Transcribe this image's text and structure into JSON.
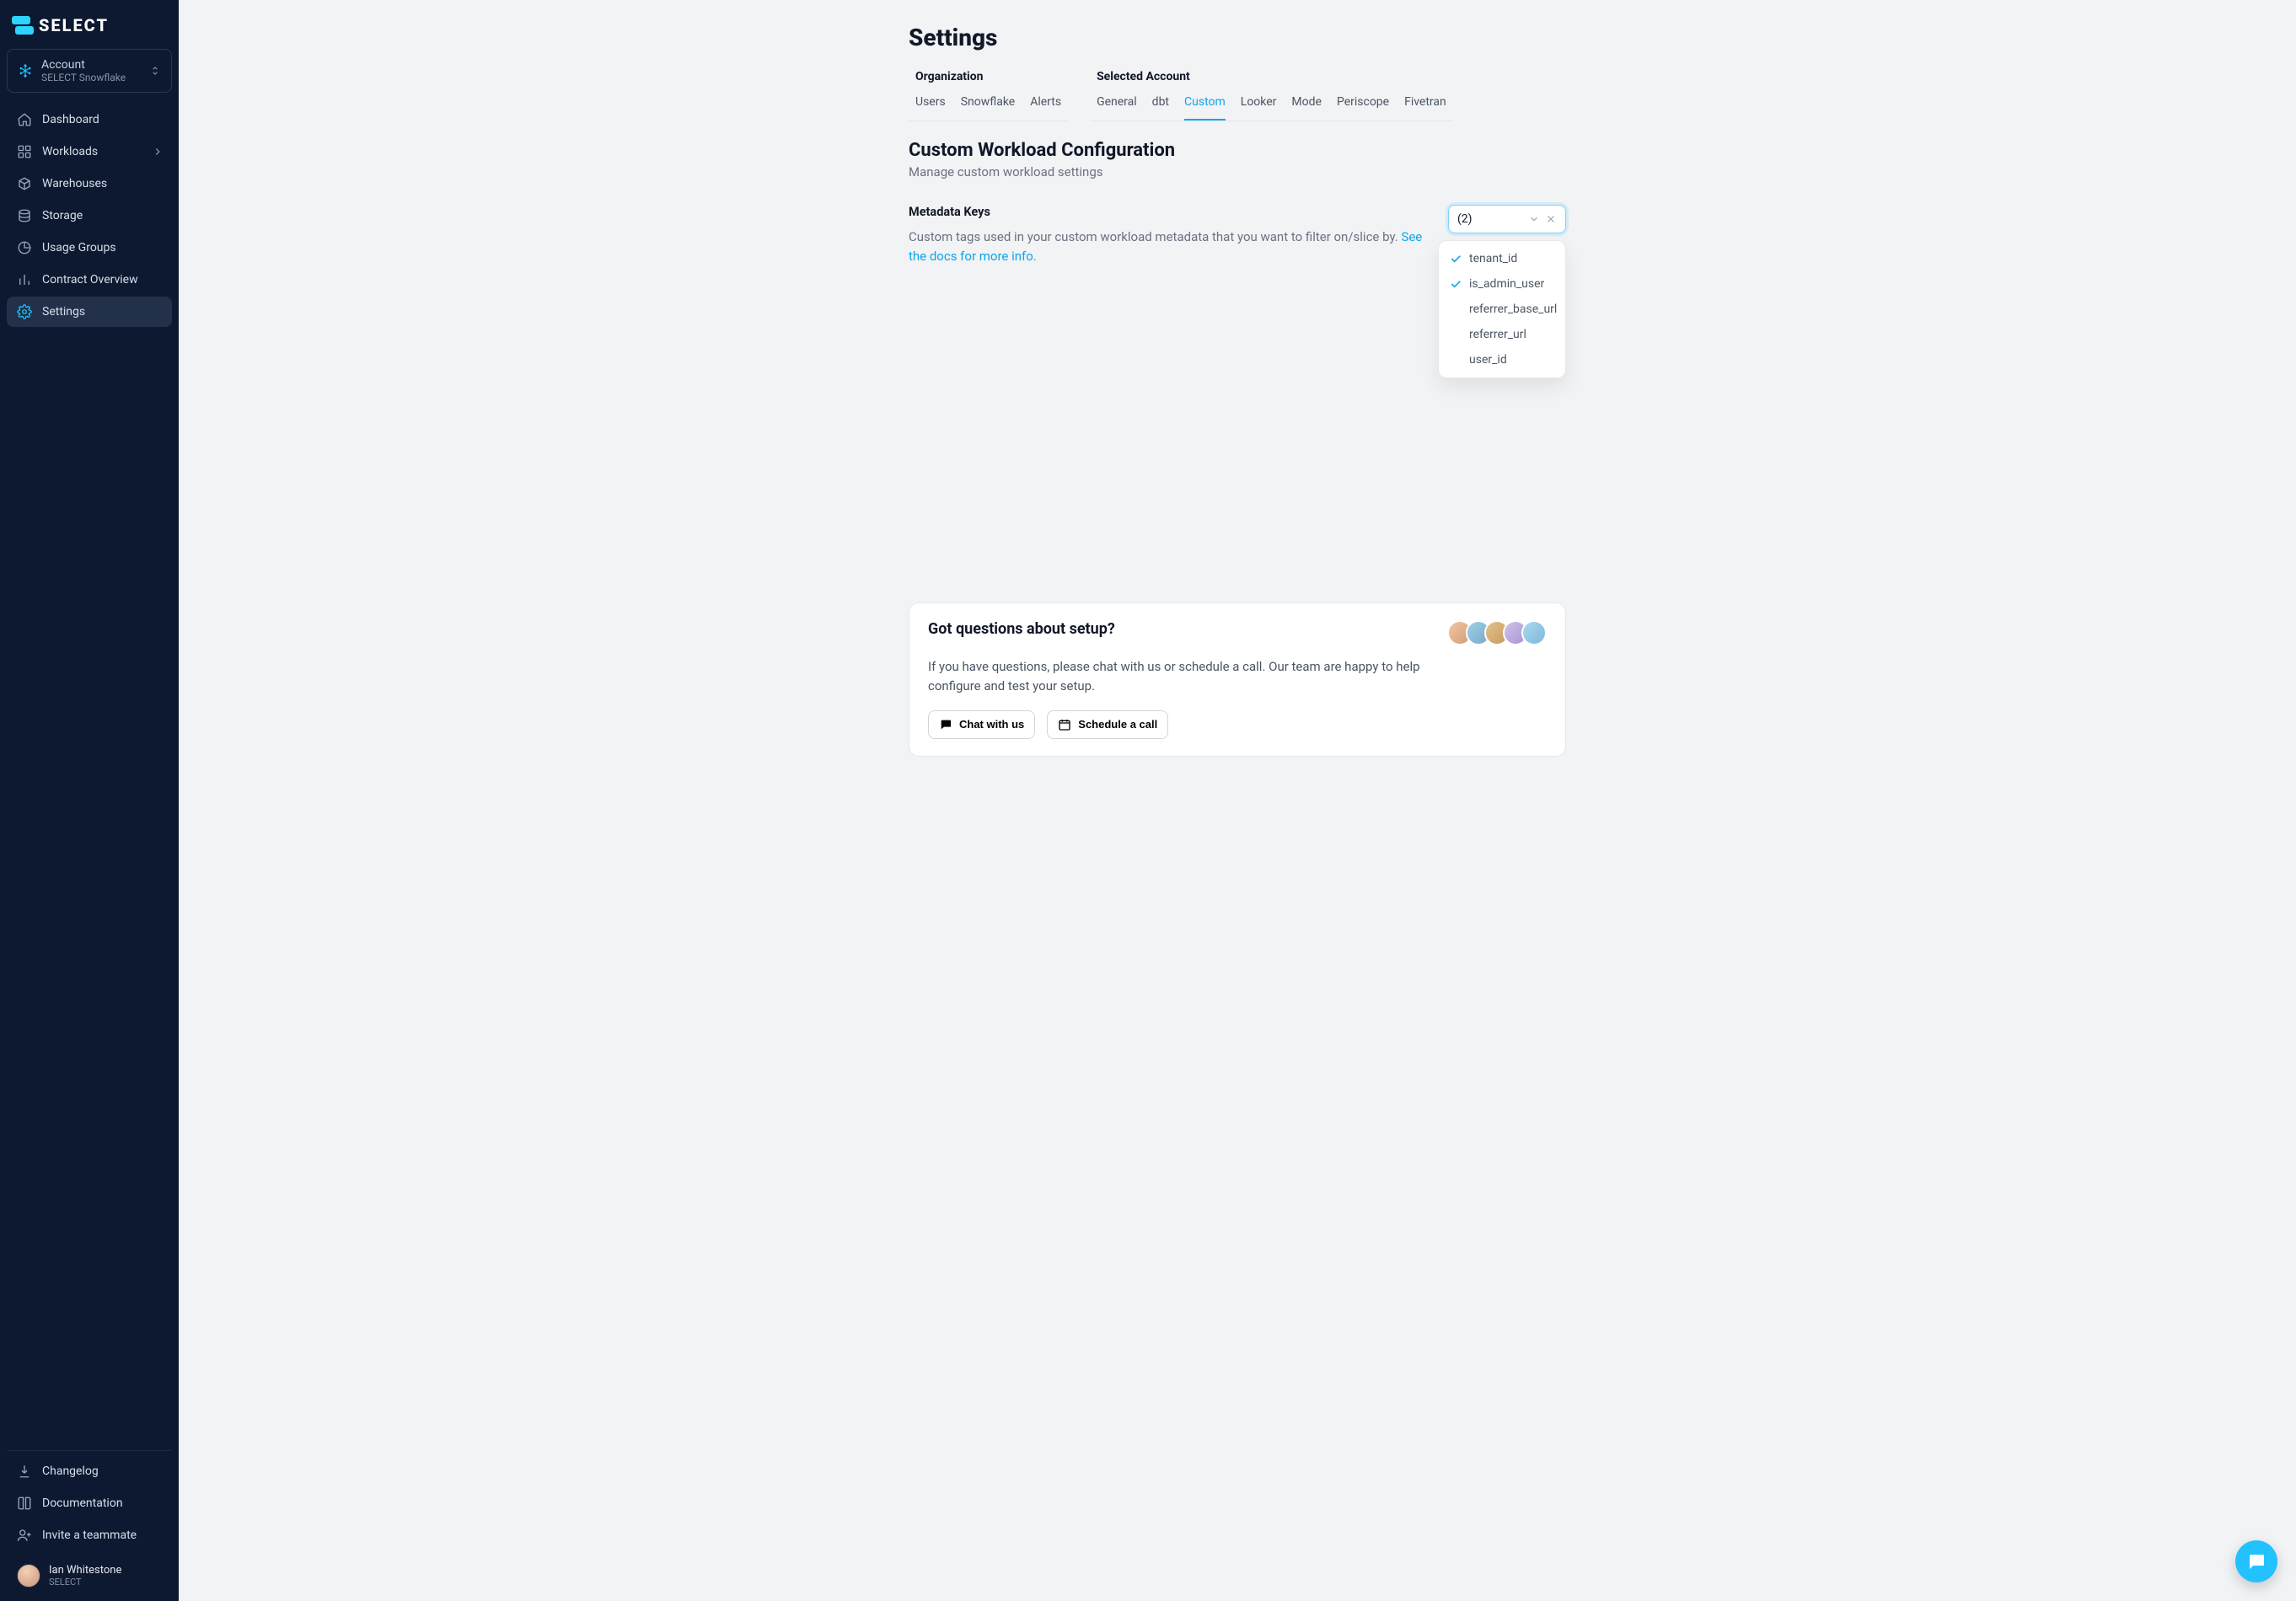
{
  "app": {
    "name": "SELECT"
  },
  "account": {
    "label": "Account",
    "value": "SELECT Snowflake"
  },
  "nav": {
    "main": [
      {
        "label": "Dashboard",
        "icon": "home",
        "chevron": false
      },
      {
        "label": "Workloads",
        "icon": "grid",
        "chevron": true
      },
      {
        "label": "Warehouses",
        "icon": "cube",
        "chevron": false
      },
      {
        "label": "Storage",
        "icon": "stack",
        "chevron": false
      },
      {
        "label": "Usage Groups",
        "icon": "pie",
        "chevron": false
      },
      {
        "label": "Contract Overview",
        "icon": "bars",
        "chevron": false
      },
      {
        "label": "Settings",
        "icon": "gear",
        "chevron": false
      }
    ],
    "bottom": [
      {
        "label": "Changelog",
        "icon": "download"
      },
      {
        "label": "Documentation",
        "icon": "book"
      },
      {
        "label": "Invite a teammate",
        "icon": "user-plus"
      }
    ]
  },
  "user": {
    "name": "Ian Whitestone",
    "org": "SELECT"
  },
  "page": {
    "title": "Settings",
    "tab_groups": {
      "organization": {
        "title": "Organization",
        "tabs": [
          "Users",
          "Snowflake",
          "Alerts"
        ]
      },
      "selected_account": {
        "title": "Selected Account",
        "tabs": [
          "General",
          "dbt",
          "Custom",
          "Looker",
          "Mode",
          "Periscope",
          "Fivetran"
        ],
        "active": "Custom"
      }
    },
    "section": {
      "title": "Custom Workload Configuration",
      "subtitle": "Manage custom workload settings"
    },
    "metadata": {
      "title": "Metadata Keys",
      "desc_prefix": "Custom tags used in your custom workload metadata that you want to filter on/slice by. ",
      "link_text": "See the docs for more info."
    },
    "metadata_select": {
      "display": "(2)",
      "options": [
        {
          "label": "tenant_id",
          "selected": true
        },
        {
          "label": "is_admin_user",
          "selected": true
        },
        {
          "label": "referrer_base_url",
          "selected": false
        },
        {
          "label": "referrer_url",
          "selected": false
        },
        {
          "label": "user_id",
          "selected": false
        }
      ]
    },
    "help": {
      "title": "Got questions about setup?",
      "desc": "If you have questions, please chat with us or schedule a call. Our team are happy to help configure and test your setup.",
      "chat_btn": "Chat with us",
      "schedule_btn": "Schedule a call"
    }
  }
}
